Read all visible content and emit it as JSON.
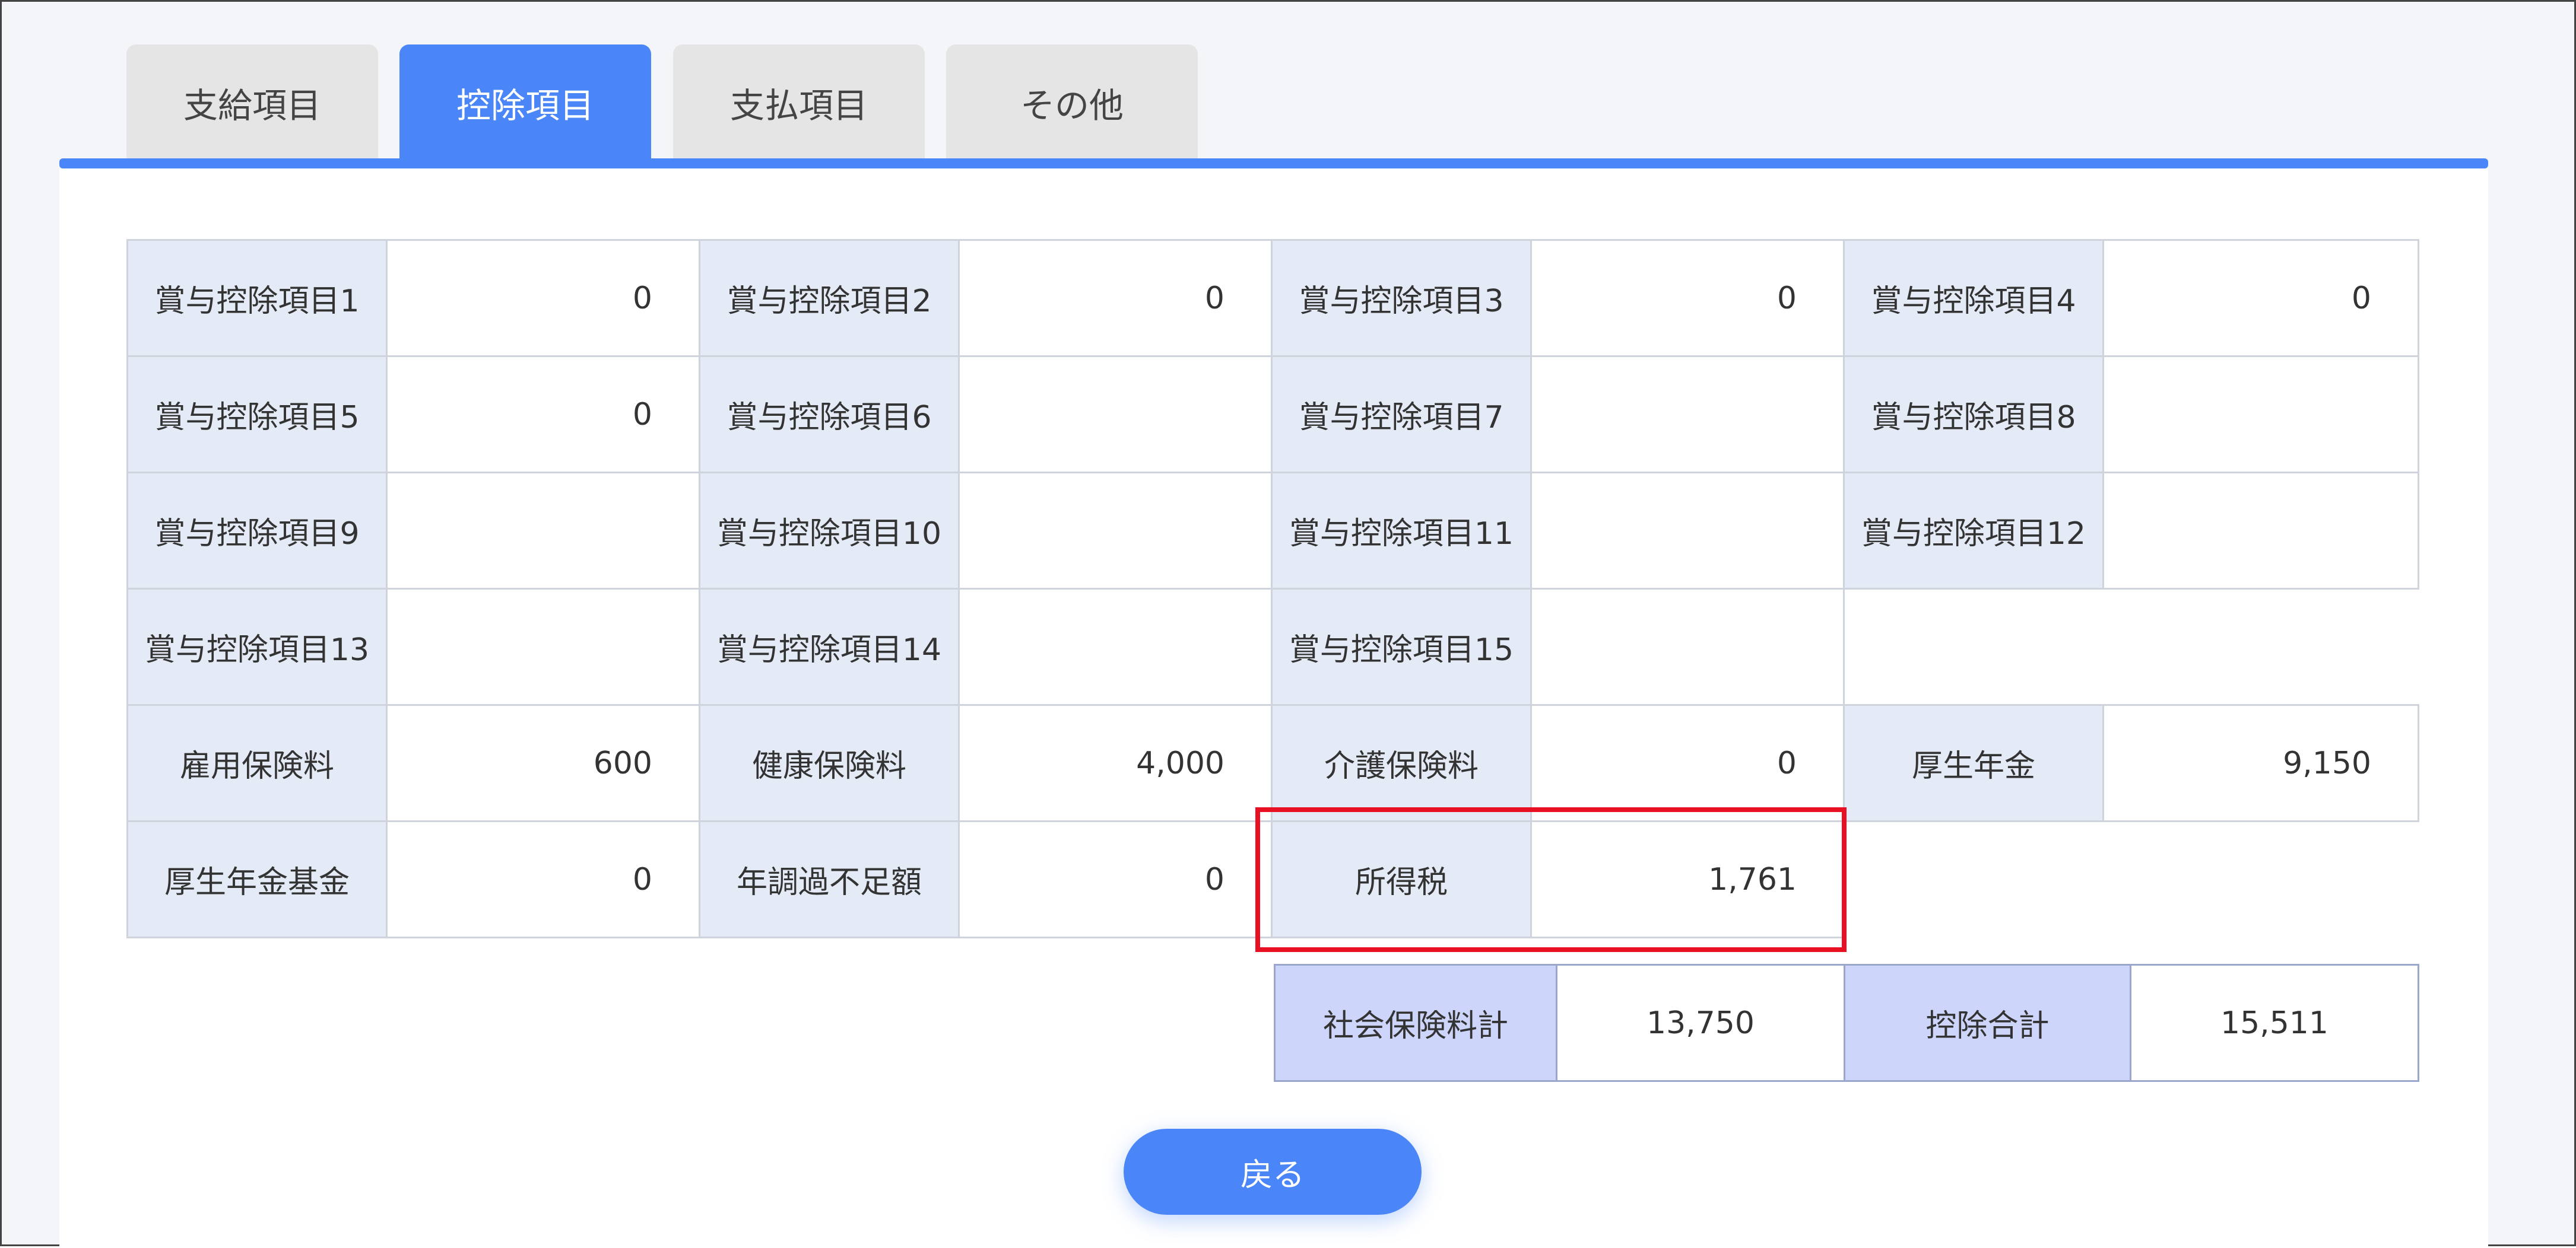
{
  "tabs": [
    {
      "label": "支給項目",
      "active": false
    },
    {
      "label": "控除項目",
      "active": true
    },
    {
      "label": "支払項目",
      "active": false
    },
    {
      "label": "その他",
      "active": false
    }
  ],
  "rows": [
    [
      {
        "label": "賞与控除項目1",
        "value": "0"
      },
      {
        "label": "賞与控除項目2",
        "value": "0"
      },
      {
        "label": "賞与控除項目3",
        "value": "0"
      },
      {
        "label": "賞与控除項目4",
        "value": "0"
      }
    ],
    [
      {
        "label": "賞与控除項目5",
        "value": "0"
      },
      {
        "label": "賞与控除項目6",
        "value": ""
      },
      {
        "label": "賞与控除項目7",
        "value": ""
      },
      {
        "label": "賞与控除項目8",
        "value": ""
      }
    ],
    [
      {
        "label": "賞与控除項目9",
        "value": ""
      },
      {
        "label": "賞与控除項目10",
        "value": ""
      },
      {
        "label": "賞与控除項目11",
        "value": ""
      },
      {
        "label": "賞与控除項目12",
        "value": ""
      }
    ],
    [
      {
        "label": "賞与控除項目13",
        "value": ""
      },
      {
        "label": "賞与控除項目14",
        "value": ""
      },
      {
        "label": "賞与控除項目15",
        "value": ""
      }
    ],
    [
      {
        "label": "雇用保険料",
        "value": "600"
      },
      {
        "label": "健康保険料",
        "value": "4,000"
      },
      {
        "label": "介護保険料",
        "value": "0"
      },
      {
        "label": "厚生年金",
        "value": "9,150"
      }
    ],
    [
      {
        "label": "厚生年金基金",
        "value": "0"
      },
      {
        "label": "年調過不足額",
        "value": "0"
      },
      {
        "label": "所得税",
        "value": "1,761"
      }
    ]
  ],
  "totals": {
    "social_label": "社会保険料計",
    "social_value": "13,750",
    "deduction_label": "控除合計",
    "deduction_value": "15,511"
  },
  "back_button": "戻る",
  "colors": {
    "accent": "#4a86f7",
    "label_bg": "#e4ebf6",
    "totals_label_bg": "#cdd5fa",
    "highlight": "#e81123"
  }
}
